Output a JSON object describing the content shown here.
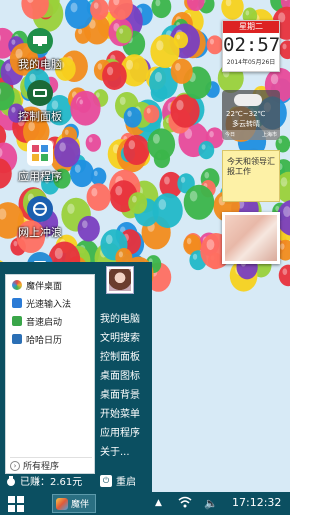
{
  "desktop": {
    "icons": [
      {
        "label": "我的电脑",
        "icon": "computer-icon"
      },
      {
        "label": "控制面板",
        "icon": "control-panel-icon"
      },
      {
        "label": "应用程序",
        "icon": "apps-icon"
      },
      {
        "label": "网上冲浪",
        "icon": "browser-icon"
      }
    ]
  },
  "widgets": {
    "clock": {
      "weekday": "星期二",
      "time": "02:57",
      "date": "2014年05月26日"
    },
    "weather": {
      "temp": "22℃~32℃",
      "desc": "多云转晴",
      "day": "今日",
      "city": "上海市"
    },
    "note": {
      "text": "今天和领导汇报工作"
    }
  },
  "start_menu": {
    "apps": [
      {
        "label": "魔伴桌面",
        "icon": "pinwheel-icon",
        "color": "#3fa0e0"
      },
      {
        "label": "光速输入法",
        "icon": "keyboard-g-icon",
        "color": "#2b7bd6"
      },
      {
        "label": "音速启动",
        "icon": "v-launcher-icon",
        "color": "#3aa64a"
      },
      {
        "label": "哈哈日历",
        "icon": "calendar-icon",
        "color": "#2b6fb5"
      }
    ],
    "all_programs": "所有程序",
    "links": [
      "我的电脑",
      "文明搜索",
      "控制面板",
      "桌面图标",
      "桌面背景",
      "开始菜单",
      "应用程序",
      "关于..."
    ],
    "earned": "已赚：2.61元",
    "restart": "重启"
  },
  "taskbar": {
    "app_label": "魔伴",
    "tray_up": "▲",
    "volume": "🔈",
    "clock": "17:12:32"
  },
  "colors": {
    "accent": "#0b4f61",
    "clock_header": "#dd2222",
    "note_bg": "#fdf1a6"
  }
}
